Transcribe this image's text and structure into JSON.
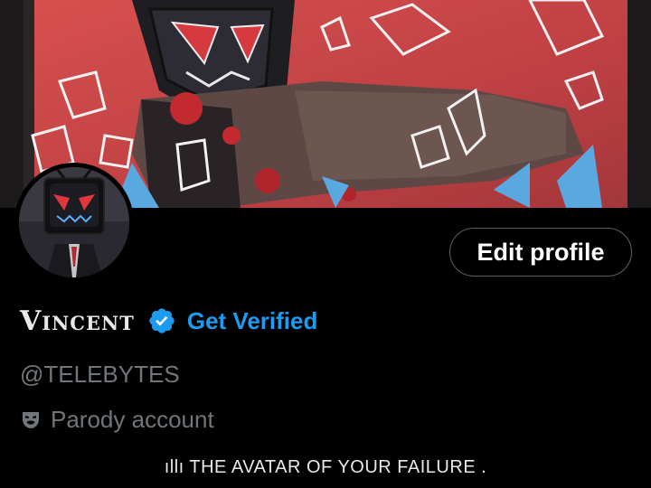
{
  "profile": {
    "display_name": "Vincent",
    "handle": "@TELEBYTES",
    "bio": "ıllı THE AVATAR OF YOUR FAILURE .",
    "parody_label": "Parody account"
  },
  "actions": {
    "edit_profile_label": "Edit profile",
    "get_verified_label": "Get Verified"
  },
  "icons": {
    "verified": "verified-badge-icon",
    "parody": "theater-mask-icon"
  },
  "colors": {
    "background": "#000000",
    "accent_blue": "#1d9bf0",
    "secondary_text": "#71767b",
    "primary_text": "#e7e9ea",
    "banner_red": "#d9484a"
  }
}
